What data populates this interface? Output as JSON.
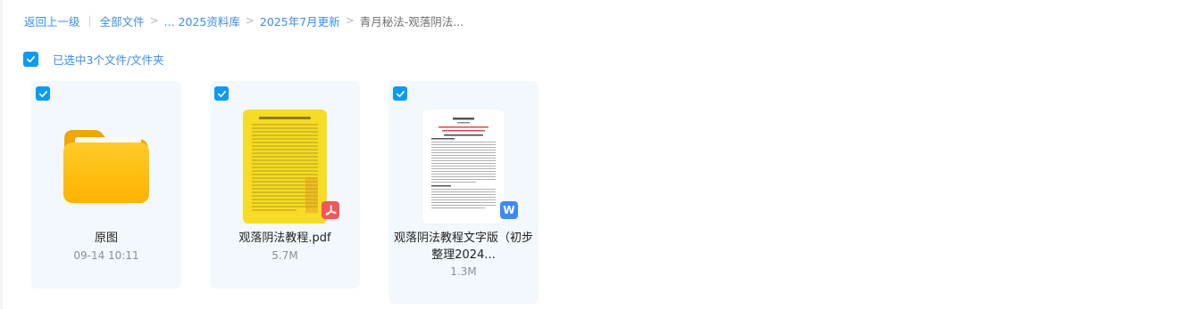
{
  "breadcrumb": {
    "back": "返回上一级",
    "all_files": "全部文件",
    "ellipsis_folder": "... 2025资料库",
    "month_folder": "2025年7月更新",
    "current": "青月秘法-观落阴法...",
    "sep": ">"
  },
  "selection": {
    "label": "已选中3个文件/文件夹"
  },
  "files": [
    {
      "name": "原图",
      "meta": "09-14 10:11",
      "type": "folder"
    },
    {
      "name": "观落阴法教程.pdf",
      "meta": "5.7M",
      "type": "pdf"
    },
    {
      "name_line1": "观落阴法教程文字版（初步",
      "name_line2": "整理2024...",
      "meta": "1.3M",
      "type": "word"
    }
  ],
  "icons": {
    "checkbox": "checkmark-icon",
    "pdf_badge": "pdf-icon",
    "word_badge": "word-icon",
    "word_badge_letter": "W",
    "folder": "folder-icon"
  },
  "colors": {
    "accent": "#0d9af2",
    "link": "#3a8ee6",
    "card_bg": "#f2f8fd",
    "pdf_badge": "#f2575c",
    "word_badge": "#3d8af7"
  }
}
